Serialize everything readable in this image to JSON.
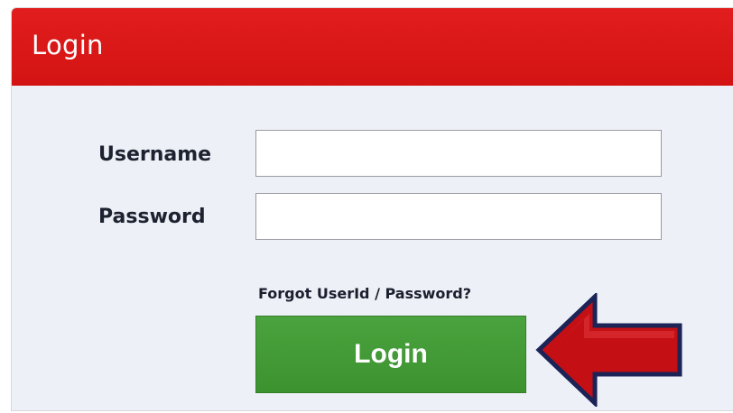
{
  "header": {
    "title": "Login"
  },
  "form": {
    "username_label": "Username",
    "password_label": "Password",
    "username_value": "",
    "password_value": "",
    "forgot_link": "Forgot UserId / Password?",
    "login_button": "Login"
  },
  "colors": {
    "header_red": "#dc1818",
    "panel_background": "#eef0f7",
    "login_green": "#449a37",
    "arrow_red": "#c40f14",
    "arrow_outline": "#1b2357"
  },
  "icons": {
    "pointer_arrow": "arrow-left-icon"
  }
}
